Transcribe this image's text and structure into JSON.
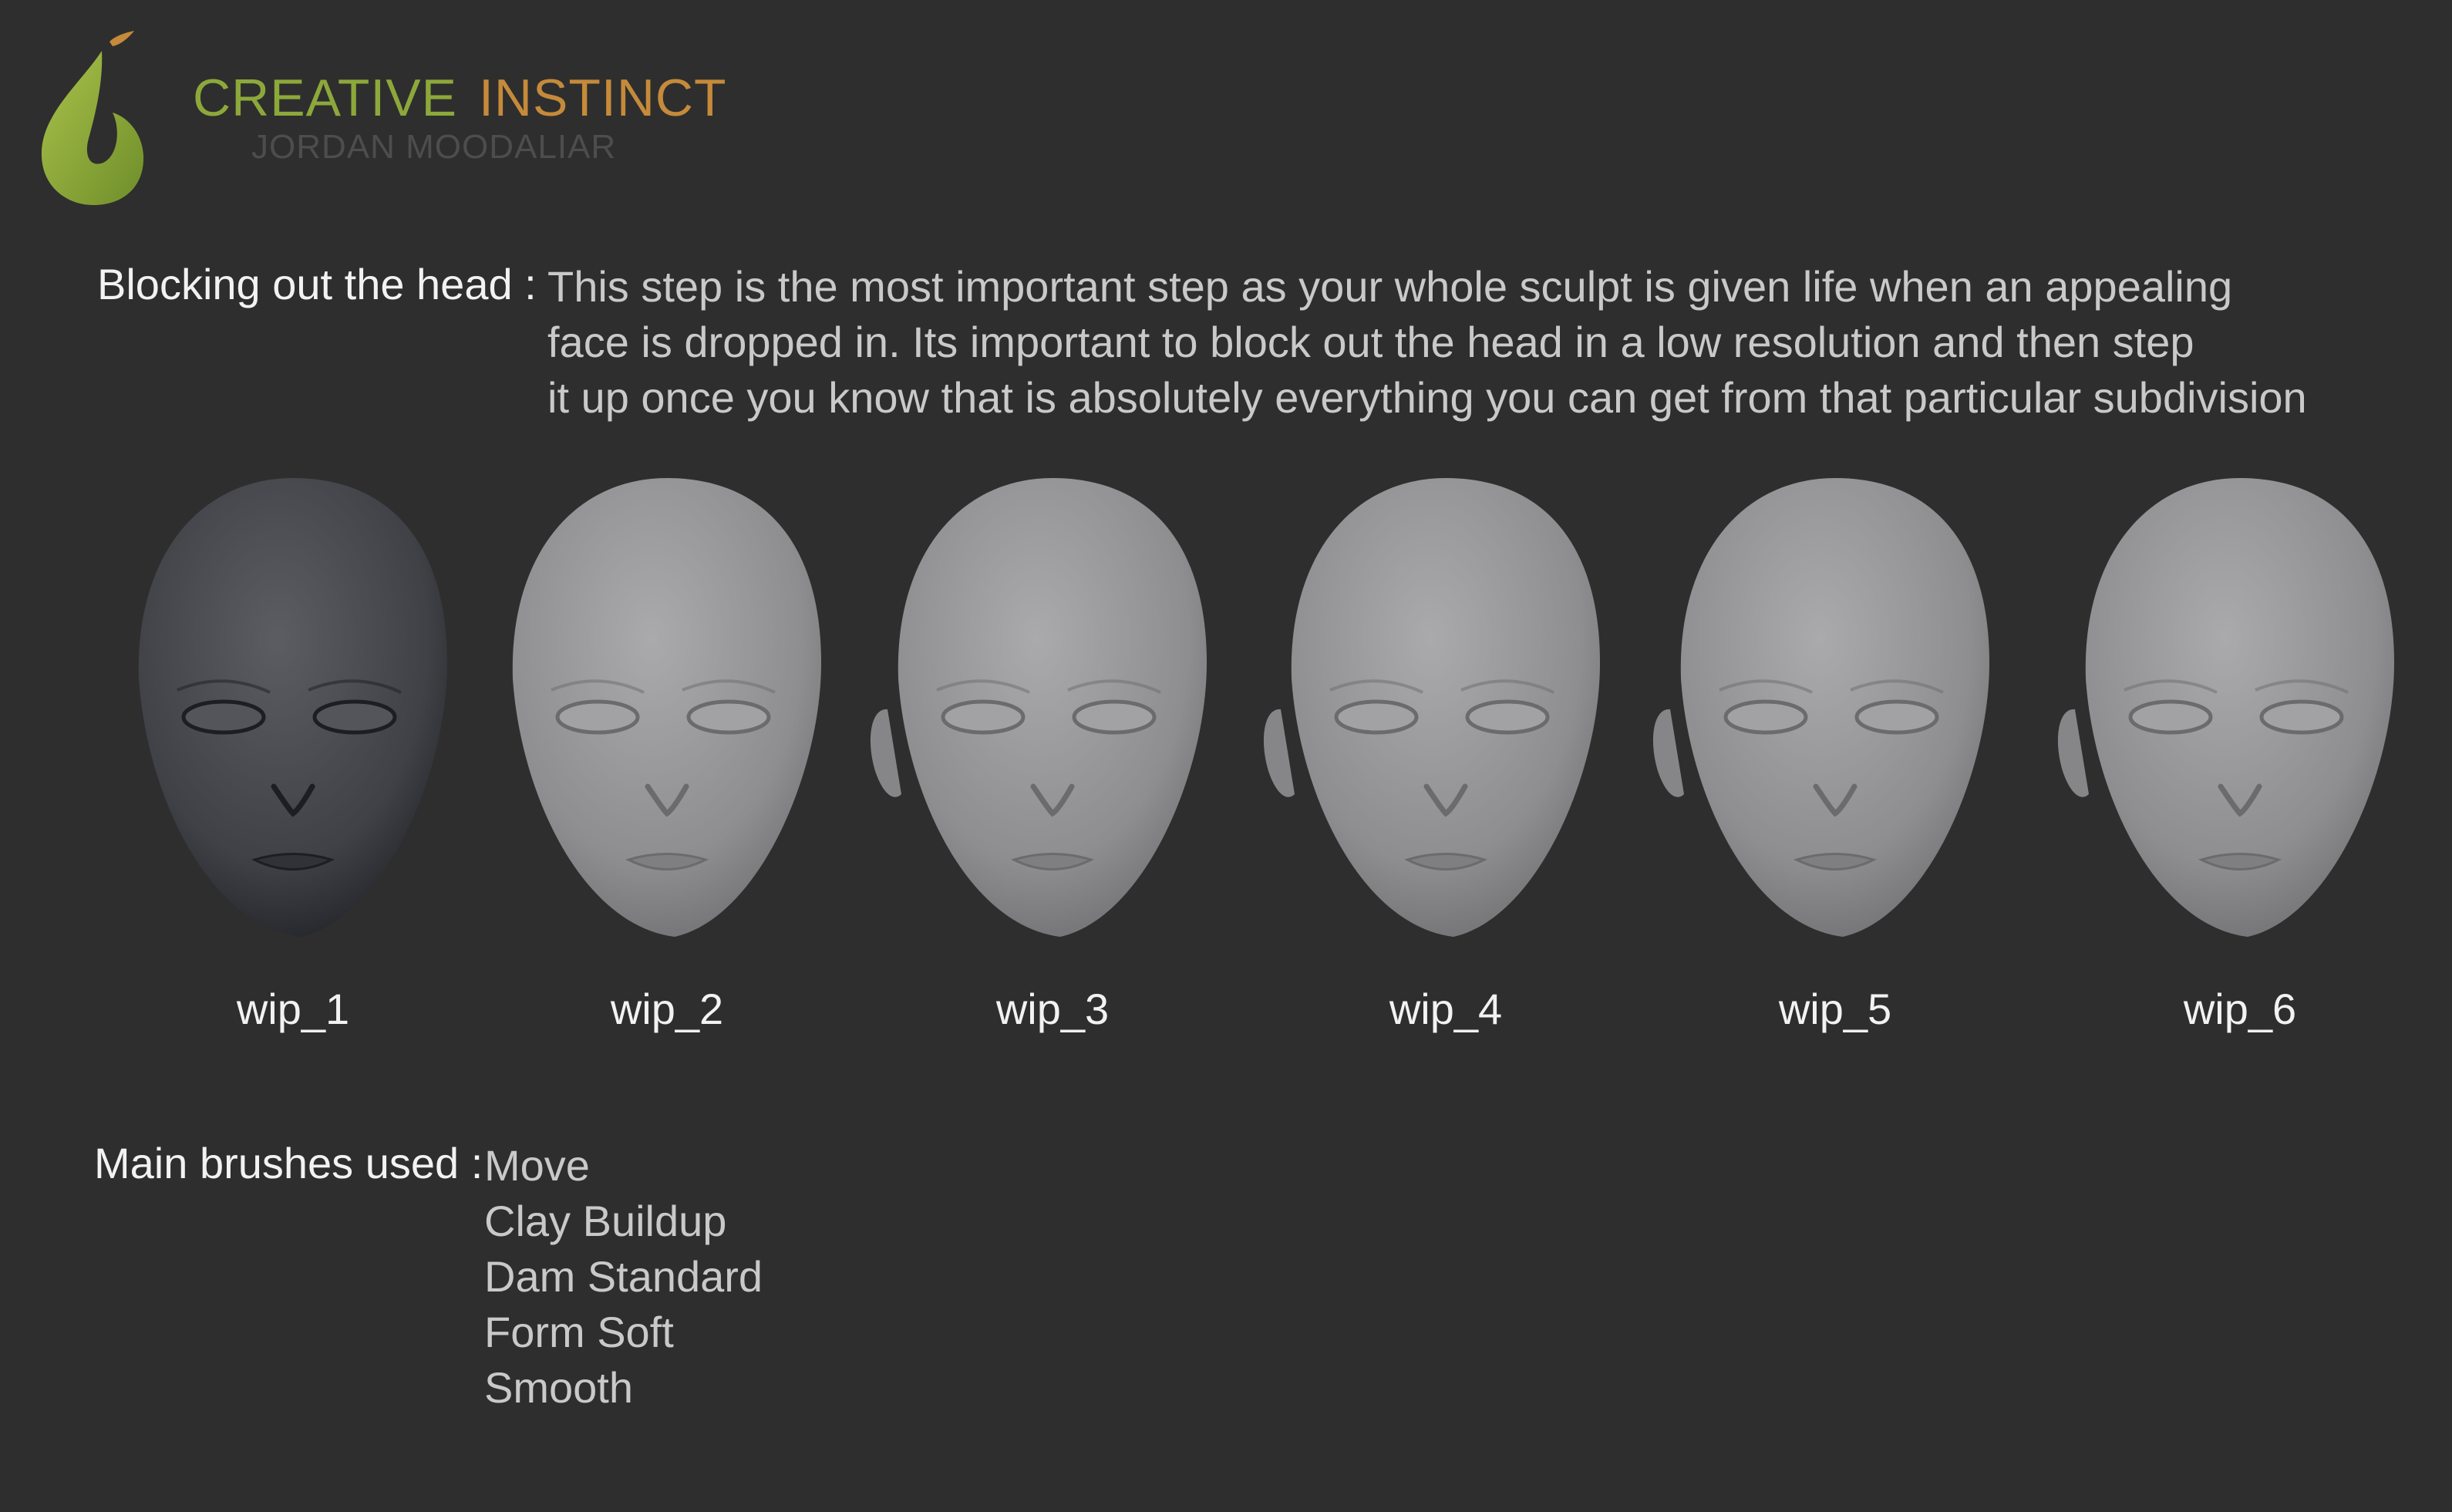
{
  "brand": {
    "title_part1": "CREATIVE",
    "title_part2": "INSTINCT",
    "subtitle": "JORDAN MOODALIAR",
    "logo_icon": "green-droplet-logo-icon",
    "colors": {
      "green": "#8da83a",
      "orange": "#c58a3a",
      "background": "#2e2e2e"
    }
  },
  "intro": {
    "label": "Blocking out the head :",
    "lines": [
      "This step is the most important step as your whole sculpt is given life when an appealing",
      "face is dropped in. Its important to block out the head in a low resolution and then step",
      "it up once you know that is absolutely everything you can get from that particular subdivision"
    ]
  },
  "heads": [
    {
      "caption": "wip_1",
      "tone": "#3f4146"
    },
    {
      "caption": "wip_2",
      "tone": "#8e8e90"
    },
    {
      "caption": "wip_3",
      "tone": "#8e8e90"
    },
    {
      "caption": "wip_4",
      "tone": "#8e8e90"
    },
    {
      "caption": "wip_5",
      "tone": "#8e8e90"
    },
    {
      "caption": "wip_6",
      "tone": "#8e8e90"
    }
  ],
  "brushes": {
    "label": "Main brushes used :",
    "items": [
      "Move",
      "Clay Buildup",
      "Dam Standard",
      "Form Soft",
      "Smooth"
    ]
  }
}
